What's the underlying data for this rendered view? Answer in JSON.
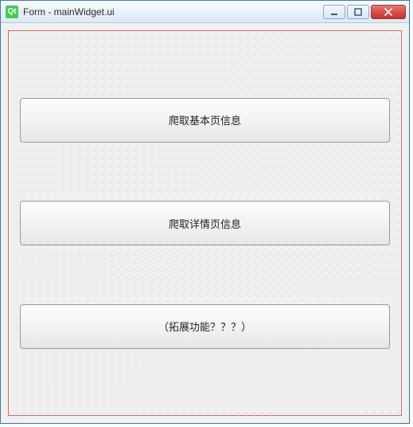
{
  "window": {
    "icon_text": "Qt",
    "title": "Form - mainWidget.ui"
  },
  "buttons": [
    {
      "label": "爬取基本页信息"
    },
    {
      "label": "爬取详情页信息"
    },
    {
      "label": "（拓展功能？？？）"
    }
  ]
}
